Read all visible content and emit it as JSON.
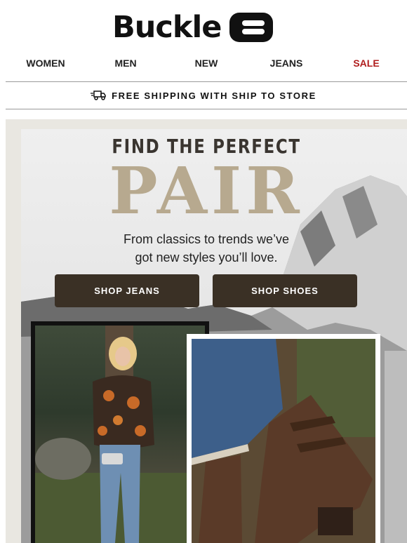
{
  "brand": {
    "name": "Buckle"
  },
  "nav": {
    "items": [
      {
        "label": "WOMEN"
      },
      {
        "label": "MEN"
      },
      {
        "label": "NEW"
      },
      {
        "label": "JEANS"
      },
      {
        "label": "SALE"
      }
    ],
    "sale_color": "#b01d1d"
  },
  "shipping_banner": {
    "icon": "truck-icon",
    "text": "FREE SHIPPING WITH SHIP TO STORE"
  },
  "hero": {
    "title_line1": "FIND THE PERFECT",
    "title_line2": "PAIR",
    "subtitle_line1": "From classics to trends we’ve",
    "subtitle_line2": "got new styles you’ll love.",
    "buttons": [
      {
        "label": "SHOP JEANS"
      },
      {
        "label": "SHOP SHOES"
      }
    ],
    "accent_color": "#b7a98f",
    "button_color": "#3a3025"
  }
}
